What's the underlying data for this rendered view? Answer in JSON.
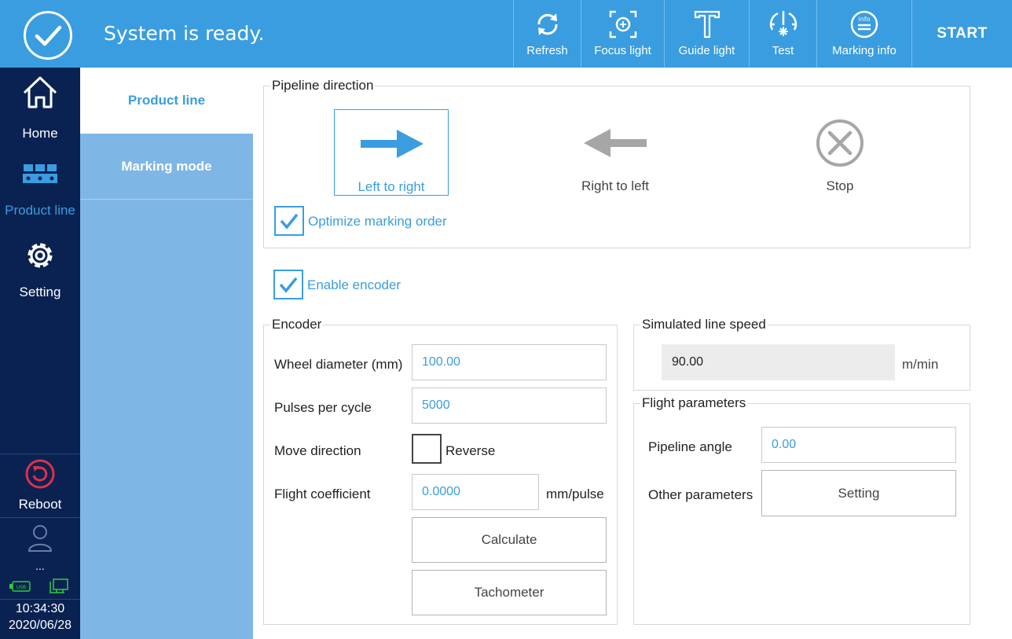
{
  "header": {
    "status": "System is ready.",
    "toolbar": [
      {
        "id": "refresh",
        "label": "Refresh",
        "icon": "refresh-icon"
      },
      {
        "id": "focus-light",
        "label": "Focus light",
        "icon": "focus-light-icon"
      },
      {
        "id": "guide-light",
        "label": "Guide light",
        "icon": "guide-light-icon"
      },
      {
        "id": "test",
        "label": "Test",
        "icon": "test-icon"
      },
      {
        "id": "marking-info",
        "label": "Marking info",
        "icon": "info-icon"
      }
    ],
    "start_label": "START"
  },
  "nav": {
    "items": [
      {
        "label": "Home",
        "icon": "home-icon"
      },
      {
        "label": "Product line",
        "icon": "product-line-icon",
        "active": true
      },
      {
        "label": "Setting",
        "icon": "gear-icon"
      }
    ],
    "reboot_label": "Reboot",
    "user_label": "...",
    "time": "10:34:30",
    "date": "2020/06/28"
  },
  "submenu": {
    "items": [
      {
        "label": "Product line",
        "active": true
      },
      {
        "label": "Marking mode",
        "active": false
      }
    ]
  },
  "pipeline": {
    "title": "Pipeline direction",
    "options": [
      {
        "label": "Left to right",
        "selected": true
      },
      {
        "label": "Right to left",
        "selected": false
      },
      {
        "label": "Stop",
        "selected": false
      }
    ],
    "optimize_label": "Optimize marking order",
    "optimize_checked": true
  },
  "encoder_enable": {
    "label": "Enable encoder",
    "checked": true
  },
  "encoder": {
    "title": "Encoder",
    "wheel_label": "Wheel diameter (mm)",
    "wheel_value": "100.00",
    "pulses_label": "Pulses per cycle",
    "pulses_value": "5000",
    "move_label": "Move direction",
    "reverse_label": "Reverse",
    "reverse_checked": false,
    "flight_label": "Flight coefficient",
    "flight_value": "0.0000",
    "flight_unit": "mm/pulse",
    "calculate_label": "Calculate",
    "tachometer_label": "Tachometer"
  },
  "speed": {
    "title": "Simulated line speed",
    "value": "90.00",
    "unit": "m/min"
  },
  "flight": {
    "title": "Flight parameters",
    "angle_label": "Pipeline angle",
    "angle_value": "0.00",
    "other_label": "Other parameters",
    "setting_label": "Setting"
  },
  "colors": {
    "header": "#3a9de0",
    "nav": "#0a2251",
    "submenu": "#7eb6e5",
    "accent": "#3a9de0",
    "reboot": "#e0304a",
    "status_green": "#2ecc40"
  }
}
